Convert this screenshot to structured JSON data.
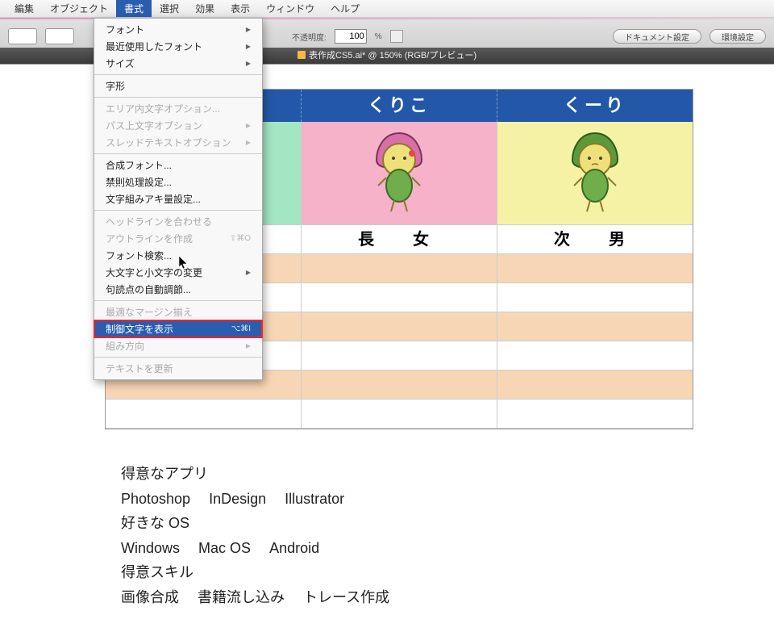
{
  "menubar": [
    "編集",
    "オブジェクト",
    "書式",
    "選択",
    "効果",
    "表示",
    "ウィンドウ",
    "ヘルプ"
  ],
  "menubar_active_index": 2,
  "dropdown": {
    "groups": [
      [
        {
          "label": "フォント",
          "sub": true
        },
        {
          "label": "最近使用したフォント",
          "sub": true
        },
        {
          "label": "サイズ",
          "sub": true
        }
      ],
      [
        {
          "label": "字形"
        }
      ],
      [
        {
          "label": "エリア内文字オプション...",
          "disabled": true
        },
        {
          "label": "パス上文字オプション",
          "sub": true,
          "disabled": true
        },
        {
          "label": "スレッドテキストオプション",
          "sub": true,
          "disabled": true
        }
      ],
      [
        {
          "label": "合成フォント..."
        },
        {
          "label": "禁則処理設定..."
        },
        {
          "label": "文字組みアキ量設定..."
        }
      ],
      [
        {
          "label": "ヘッドラインを合わせる",
          "disabled": true
        },
        {
          "label": "アウトラインを作成",
          "shortcut": "⇧⌘O",
          "disabled": true
        },
        {
          "label": "フォント検索..."
        },
        {
          "label": "大文字と小文字の変更",
          "sub": true
        },
        {
          "label": "句読点の自動調節..."
        }
      ],
      [
        {
          "label": "最適なマージン揃え",
          "disabled": true
        },
        {
          "label": "制御文字を表示",
          "shortcut": "⌥⌘I",
          "highlighted": true
        },
        {
          "label": "組み方向",
          "sub": true,
          "disabled": true
        }
      ],
      [
        {
          "label": "テキストを更新",
          "disabled": true
        }
      ]
    ]
  },
  "toolbar": {
    "opacity_label": "不透明度:",
    "opacity_value": "100",
    "percent": "%",
    "btn_doc": "ドキュメント設定",
    "btn_env": "環境設定"
  },
  "document_tab": "表作成CS5.ai* @ 150% (RGB/プレビュー)",
  "table": {
    "headers": [
      "",
      "くりこ",
      "くーり"
    ],
    "labels": [
      "",
      "長　女",
      "次　男"
    ]
  },
  "article": {
    "h1": "得意なアプリ",
    "l1": [
      "Photoshop",
      "InDesign",
      "Illustrator"
    ],
    "h2": "好きな OS",
    "l2": [
      "Windows",
      "Mac OS",
      "Android"
    ],
    "h3": "得意スキル",
    "l3": [
      "画像合成",
      "書籍流し込み",
      "トレース作成"
    ]
  }
}
